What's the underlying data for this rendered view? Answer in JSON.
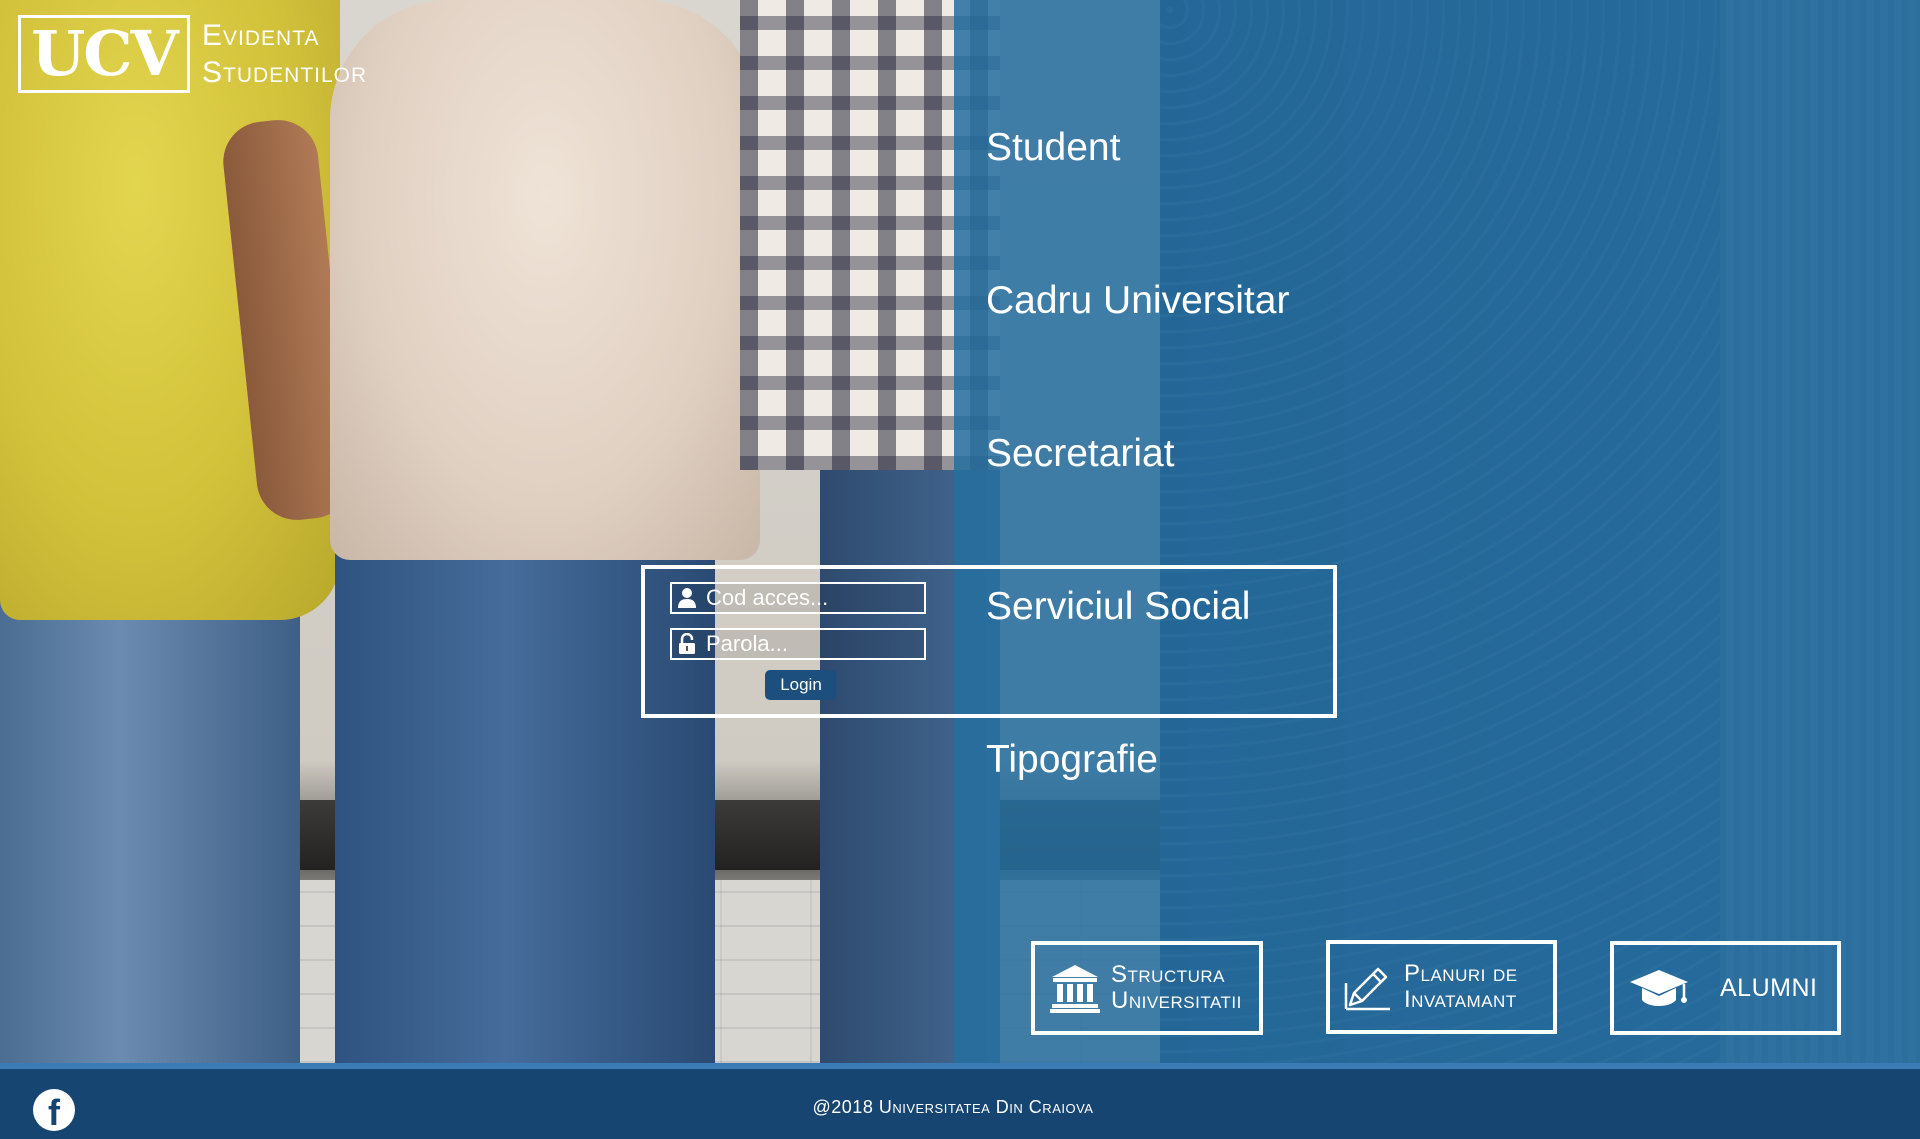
{
  "header": {
    "logo_mark": "UCV",
    "logo_line1": "Evidenta",
    "logo_line2": "Studentilor"
  },
  "menu": {
    "items": [
      {
        "label": "Student"
      },
      {
        "label": "Cadru Universitar"
      },
      {
        "label": "Secretariat"
      },
      {
        "label": "Serviciul Social"
      },
      {
        "label": "Tipografie"
      }
    ]
  },
  "login": {
    "username_placeholder": "Cod acces...",
    "password_placeholder": "Parola...",
    "button_label": "Login",
    "user_icon": "user-icon",
    "lock_icon": "lock-icon"
  },
  "quick_links": [
    {
      "label": "Structura\nUniversitatii",
      "icon": "institution-icon"
    },
    {
      "label": "Planuri de\nInvatamant",
      "icon": "pencil-icon"
    },
    {
      "label": "ALUMNI",
      "icon": "graduation-cap-icon"
    }
  ],
  "footer": {
    "copyright": "@2018 Universitatea Din Craiova",
    "facebook_glyph": "f",
    "facebook_icon": "facebook-icon"
  },
  "colors": {
    "overlay_blue": "#256fa0",
    "footer_blue": "#174572",
    "footer_accent": "#3b7bb6",
    "login_button": "#1c4f7e",
    "white": "#ffffff"
  }
}
